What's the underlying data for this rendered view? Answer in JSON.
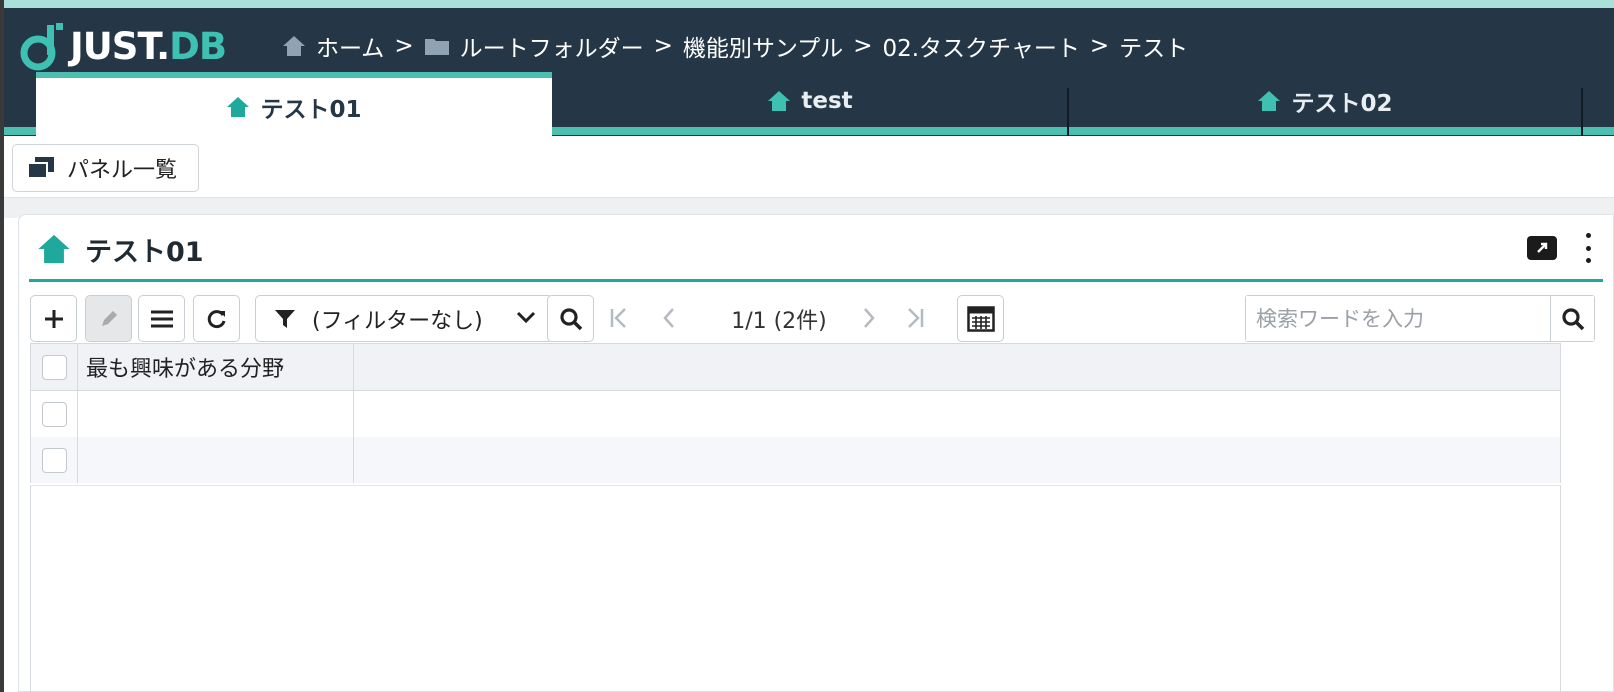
{
  "app": {
    "logo_main": "JUST.",
    "logo_accent": "DB"
  },
  "breadcrumb": {
    "items": [
      {
        "label": "ホーム",
        "icon": "home-icon"
      },
      {
        "label": "ルートフォルダー",
        "icon": "folder-icon"
      },
      {
        "label": "機能別サンプル"
      },
      {
        "label": "02.タスクチャート"
      },
      {
        "label": "テスト"
      }
    ],
    "separator": ">"
  },
  "tabs": [
    {
      "label": "テスト01",
      "active": true,
      "icon": "home-icon"
    },
    {
      "label": "test",
      "active": false,
      "icon": "home-icon"
    },
    {
      "label": "テスト02",
      "active": false,
      "icon": "home-icon"
    }
  ],
  "toolbar": {
    "panel_list_label": "パネル一覧"
  },
  "panel": {
    "title": "テスト01",
    "filter_label": "(フィルターなし)",
    "page_info": "1/1 (2件)",
    "search_placeholder": "検索ワードを入力"
  },
  "table": {
    "columns": [
      "最も興味がある分野"
    ],
    "rows": [
      {
        "value": ""
      },
      {
        "value": ""
      }
    ]
  },
  "colors": {
    "header_bg": "#253746",
    "accent": "#4dbfb1",
    "panel_accent": "#1fa99c"
  }
}
